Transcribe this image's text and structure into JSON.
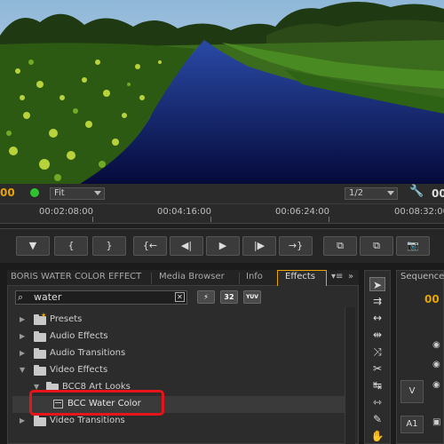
{
  "monitor": {
    "timecode_left": "00",
    "fit_label": "Fit",
    "resolution_label": "1/2",
    "timecode_right": "00",
    "wrench_icon": "wrench-icon"
  },
  "ruler": {
    "labels": [
      "00:02:08:00",
      "00:04:16:00",
      "00:06:24:00",
      "00:08:32:00"
    ]
  },
  "transport": {
    "buttons": [
      {
        "name": "marker-button",
        "glyph": "▼"
      },
      {
        "name": "mark-in-button",
        "glyph": "{"
      },
      {
        "name": "mark-out-button",
        "glyph": "}"
      },
      {
        "name": "go-to-in-button",
        "glyph": "{←"
      },
      {
        "name": "step-back-button",
        "glyph": "◀|"
      },
      {
        "name": "play-button",
        "glyph": "▶"
      },
      {
        "name": "step-forward-button",
        "glyph": "|▶"
      },
      {
        "name": "go-to-out-button",
        "glyph": "→}"
      },
      {
        "name": "insert-button",
        "glyph": "⧉"
      },
      {
        "name": "overwrite-button",
        "glyph": "⧉"
      },
      {
        "name": "export-frame-button",
        "glyph": "📷"
      }
    ]
  },
  "panel_tabs": {
    "boris": "BORIS WATER COLOR EFFECT",
    "media_browser": "Media Browser",
    "info": "Info",
    "effects": "Effects",
    "menu": "▾≡",
    "more": "»"
  },
  "effects": {
    "search_value": "water",
    "buttons": {
      "accelerated": "⚡",
      "bit32": "32",
      "yuv": "YUV"
    },
    "tree": [
      {
        "label": "Presets",
        "expanded": false,
        "level": 0,
        "icon": "folder-star-icon"
      },
      {
        "label": "Audio Effects",
        "expanded": false,
        "level": 0,
        "icon": "folder-icon"
      },
      {
        "label": "Audio Transitions",
        "expanded": false,
        "level": 0,
        "icon": "folder-icon"
      },
      {
        "label": "Video Effects",
        "expanded": true,
        "level": 0,
        "icon": "folder-icon"
      },
      {
        "label": "BCC8 Art Looks",
        "expanded": true,
        "level": 1,
        "icon": "folder-icon"
      },
      {
        "label": "BCC Water Color",
        "expanded": null,
        "level": 2,
        "icon": "effect-icon",
        "selected": true
      },
      {
        "label": "Video Transitions",
        "expanded": false,
        "level": 0,
        "icon": "folder-icon"
      }
    ]
  },
  "sequence": {
    "tab": "Sequence",
    "timecode": "00",
    "track_v": "V",
    "track_a1": "A1"
  },
  "colors": {
    "accent_orange": "#e8a400",
    "highlight_red": "#e8141c",
    "status_green": "#2fc42f"
  }
}
